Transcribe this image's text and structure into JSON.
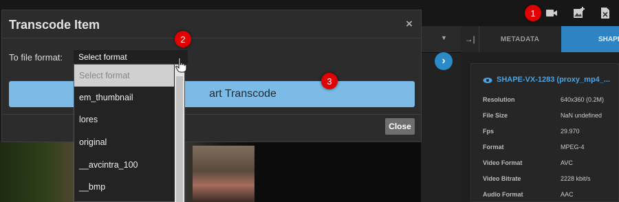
{
  "modal": {
    "title": "Transcode Item",
    "close_x": "×",
    "field_label": "To file format:",
    "select_value": "Select format",
    "start_button": "Start Transcode",
    "start_visible_text": "art Transcode",
    "close_button": "Close"
  },
  "dropdown": {
    "options": [
      "Select format",
      "em_thumbnail",
      "lores",
      "original",
      "__avcintra_100",
      "__bmp"
    ],
    "selected_index": 0
  },
  "right_panel": {
    "tab_metadata": "METADATA",
    "tab_shape": "SHAPE",
    "shape_title": "SHAPE-VX-1283 (proxy_mp4_...",
    "rows": [
      {
        "label": "Resolution",
        "value": "640x360 (0.2M)"
      },
      {
        "label": "File Size",
        "value": "NaN undefined"
      },
      {
        "label": "Fps",
        "value": "29.970"
      },
      {
        "label": "Format",
        "value": "MPEG-4"
      },
      {
        "label": "Video Format",
        "value": "AVC"
      },
      {
        "label": "Video Bitrate",
        "value": "2228 kbit/s"
      },
      {
        "label": "Audio Format",
        "value": "AAC"
      }
    ]
  },
  "markers": [
    "1",
    "2",
    "3"
  ],
  "icons": {
    "top": [
      "video-camera-icon",
      "add-image-icon",
      "document-x-icon"
    ],
    "collapse": "arrow-right-bar-icon",
    "play": "chevron-right-icon"
  },
  "colors": {
    "accent": "#2e83c2",
    "start_button": "#7bbbe6",
    "marker": "#e30000"
  }
}
